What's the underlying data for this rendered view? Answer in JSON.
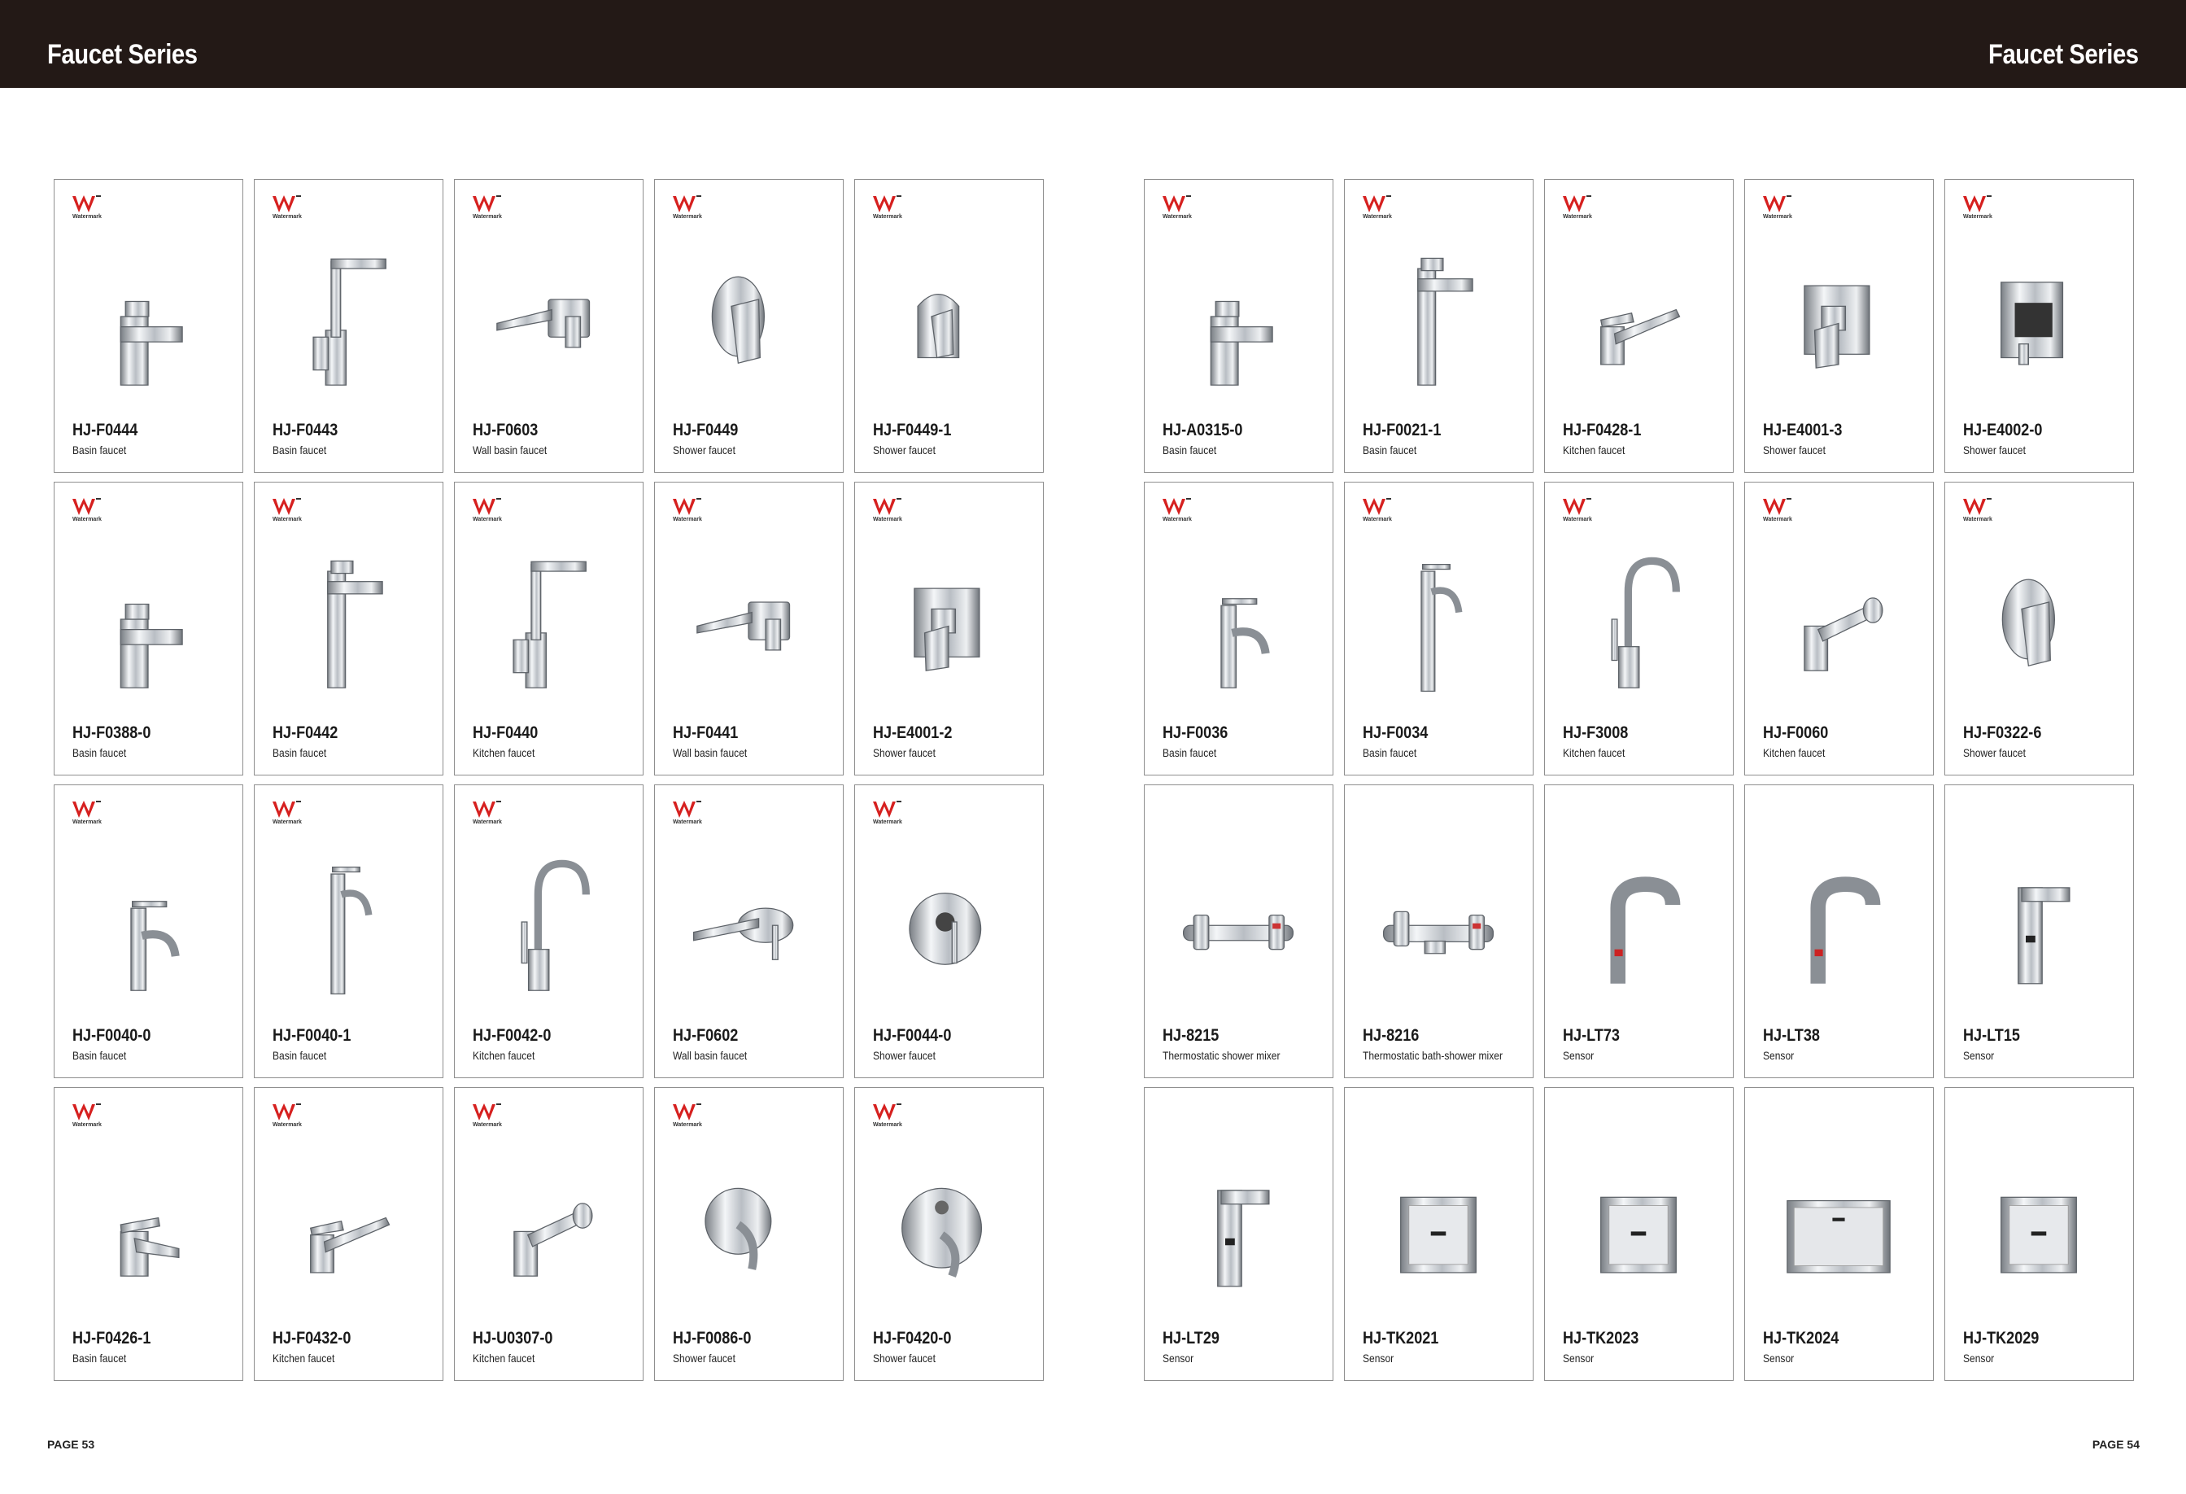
{
  "header": {
    "left_title": "Faucet Series",
    "right_title": "Faucet Series",
    "background": "#231916"
  },
  "watermark": {
    "label": "Watermark",
    "accent": "#d6201f"
  },
  "left_page": {
    "page_number": "PAGE 53",
    "products": [
      {
        "model": "HJ-F0444",
        "description": "Basin faucet",
        "watermark": true,
        "icon": "square-basin-faucet-icon"
      },
      {
        "model": "HJ-F0443",
        "description": "Basin faucet",
        "watermark": true,
        "icon": "tall-square-kitchen-faucet-icon"
      },
      {
        "model": "HJ-F0603",
        "description": "Wall basin faucet",
        "watermark": true,
        "icon": "wall-spout-icon"
      },
      {
        "model": "HJ-F0449",
        "description": "Shower faucet",
        "watermark": true,
        "icon": "shower-mixer-oval-icon"
      },
      {
        "model": "HJ-F0449-1",
        "description": "Shower faucet",
        "watermark": true,
        "icon": "shower-mixer-small-icon"
      },
      {
        "model": "HJ-F0388-0",
        "description": "Basin faucet",
        "watermark": true,
        "icon": "square-basin-faucet-icon"
      },
      {
        "model": "HJ-F0442",
        "description": "Basin faucet",
        "watermark": true,
        "icon": "tall-square-basin-faucet-icon"
      },
      {
        "model": "HJ-F0440",
        "description": "Kitchen faucet",
        "watermark": true,
        "icon": "square-kitchen-faucet-icon"
      },
      {
        "model": "HJ-F0441",
        "description": "Wall basin faucet",
        "watermark": true,
        "icon": "wall-spout-icon"
      },
      {
        "model": "HJ-E4001-2",
        "description": "Shower faucet",
        "watermark": true,
        "icon": "shower-mixer-square-icon"
      },
      {
        "model": "HJ-F0040-0",
        "description": "Basin faucet",
        "watermark": true,
        "icon": "round-basin-faucet-icon"
      },
      {
        "model": "HJ-F0040-1",
        "description": "Basin faucet",
        "watermark": true,
        "icon": "tall-round-basin-faucet-icon"
      },
      {
        "model": "HJ-F0042-0",
        "description": "Kitchen faucet",
        "watermark": true,
        "icon": "gooseneck-kitchen-faucet-icon"
      },
      {
        "model": "HJ-F0602",
        "description": "Wall basin faucet",
        "watermark": true,
        "icon": "wall-spout-oval-icon"
      },
      {
        "model": "HJ-F0044-0",
        "description": "Shower faucet",
        "watermark": true,
        "icon": "shower-mixer-round-icon"
      },
      {
        "model": "HJ-F0426-1",
        "description": "Basin faucet",
        "watermark": true,
        "icon": "lever-basin-faucet-icon"
      },
      {
        "model": "HJ-F0432-0",
        "description": "Kitchen faucet",
        "watermark": true,
        "icon": "long-spout-kitchen-faucet-icon"
      },
      {
        "model": "HJ-U0307-0",
        "description": "Kitchen faucet",
        "watermark": true,
        "icon": "pullout-kitchen-faucet-icon"
      },
      {
        "model": "HJ-F0086-0",
        "description": "Shower faucet",
        "watermark": true,
        "icon": "shower-mixer-lever-icon"
      },
      {
        "model": "HJ-F0420-0",
        "description": "Shower faucet",
        "watermark": true,
        "icon": "shower-diverter-icon"
      }
    ]
  },
  "right_page": {
    "page_number": "PAGE 54",
    "products": [
      {
        "model": "HJ-A0315-0",
        "description": "Basin faucet",
        "watermark": true,
        "icon": "square-basin-faucet-icon"
      },
      {
        "model": "HJ-F0021-1",
        "description": "Basin faucet",
        "watermark": true,
        "icon": "tall-square-basin-faucet-icon"
      },
      {
        "model": "HJ-F0428-1",
        "description": "Kitchen faucet",
        "watermark": true,
        "icon": "long-spout-kitchen-faucet-icon"
      },
      {
        "model": "HJ-E4001-3",
        "description": "Shower faucet",
        "watermark": true,
        "icon": "shower-mixer-square-icon"
      },
      {
        "model": "HJ-E4002-0",
        "description": "Shower faucet",
        "watermark": true,
        "icon": "shower-diverter-square-icon"
      },
      {
        "model": "HJ-F0036",
        "description": "Basin faucet",
        "watermark": true,
        "icon": "round-basin-faucet-icon"
      },
      {
        "model": "HJ-F0034",
        "description": "Basin faucet",
        "watermark": true,
        "icon": "tall-round-basin-faucet-icon"
      },
      {
        "model": "HJ-F3008",
        "description": "Kitchen faucet",
        "watermark": true,
        "icon": "gooseneck-kitchen-faucet-icon"
      },
      {
        "model": "HJ-F0060",
        "description": "Kitchen faucet",
        "watermark": true,
        "icon": "pullout-kitchen-faucet-icon"
      },
      {
        "model": "HJ-F0322-6",
        "description": "Shower faucet",
        "watermark": true,
        "icon": "shower-mixer-oval-icon"
      },
      {
        "model": "HJ-8215",
        "description": "Thermostatic shower mixer",
        "watermark": false,
        "icon": "thermostatic-mixer-icon"
      },
      {
        "model": "HJ-8216",
        "description": "Thermostatic bath-shower mixer",
        "watermark": false,
        "icon": "thermostatic-bath-mixer-icon"
      },
      {
        "model": "HJ-LT73",
        "description": "Sensor",
        "watermark": false,
        "icon": "sensor-faucet-icon"
      },
      {
        "model": "HJ-LT38",
        "description": "Sensor",
        "watermark": false,
        "icon": "sensor-faucet-icon"
      },
      {
        "model": "HJ-LT15",
        "description": "Sensor",
        "watermark": false,
        "icon": "sensor-faucet-square-icon"
      },
      {
        "model": "HJ-LT29",
        "description": "Sensor",
        "watermark": false,
        "icon": "sensor-faucet-square-icon"
      },
      {
        "model": "HJ-TK2021",
        "description": "Sensor",
        "watermark": false,
        "icon": "sensor-panel-icon"
      },
      {
        "model": "HJ-TK2023",
        "description": "Sensor",
        "watermark": false,
        "icon": "sensor-panel-icon"
      },
      {
        "model": "HJ-TK2024",
        "description": "Sensor",
        "watermark": false,
        "icon": "sensor-panel-wide-icon"
      },
      {
        "model": "HJ-TK2029",
        "description": "Sensor",
        "watermark": false,
        "icon": "sensor-panel-icon"
      }
    ]
  }
}
